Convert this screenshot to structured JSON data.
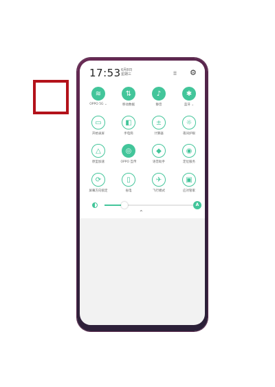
{
  "status": {
    "time": "17:53",
    "date_line1": "6月8日",
    "date_line2": "星期三"
  },
  "icons": {
    "grid": "grid-icon",
    "settings": "gear-icon"
  },
  "tiles": [
    {
      "label": "OPPO 5G ⌄",
      "icon": "wifi-icon",
      "glyph": "≋",
      "state": "on"
    },
    {
      "label": "移动数据",
      "icon": "mobile-data-icon",
      "glyph": "⇅",
      "state": "on"
    },
    {
      "label": "静音",
      "icon": "silent-bell-icon",
      "glyph": "♪",
      "state": "on"
    },
    {
      "label": "蓝牙 ⌄",
      "icon": "bluetooth-icon",
      "glyph": "✱",
      "state": "on"
    },
    {
      "label": "开始录屏",
      "icon": "screen-record-icon",
      "glyph": "▭",
      "state": "off"
    },
    {
      "label": "手电筒",
      "icon": "flashlight-icon",
      "glyph": "◧",
      "state": "off"
    },
    {
      "label": "计算器",
      "icon": "calculator-icon",
      "glyph": "±",
      "state": "off"
    },
    {
      "label": "夜间护眼",
      "icon": "eye-comfort-icon",
      "glyph": "☼",
      "state": "off"
    },
    {
      "label": "原型加速",
      "icon": "game-boost-icon",
      "glyph": "△",
      "state": "off"
    },
    {
      "label": "OPPO 互传",
      "icon": "oppo-share-icon",
      "glyph": "◎",
      "state": "on"
    },
    {
      "label": "语音助手",
      "icon": "voice-assistant-icon",
      "glyph": "◆",
      "state": "off"
    },
    {
      "label": "定位服务",
      "icon": "location-icon",
      "glyph": "◉",
      "state": "off"
    },
    {
      "label": "屏幕方向锁定",
      "icon": "rotation-lock-icon",
      "glyph": "⟳",
      "state": "off"
    },
    {
      "label": "省电",
      "icon": "battery-saver-icon",
      "glyph": "▯",
      "state": "off"
    },
    {
      "label": "飞行模式",
      "icon": "airplane-icon",
      "glyph": "✈",
      "state": "off"
    },
    {
      "label": "应对管家",
      "icon": "screenshot-icon",
      "glyph": "▣",
      "state": "off"
    }
  ],
  "brightness": {
    "level": 0.22,
    "auto_label": "A"
  },
  "accent_color": "#43c59a",
  "highlight_color": "#b3121a"
}
